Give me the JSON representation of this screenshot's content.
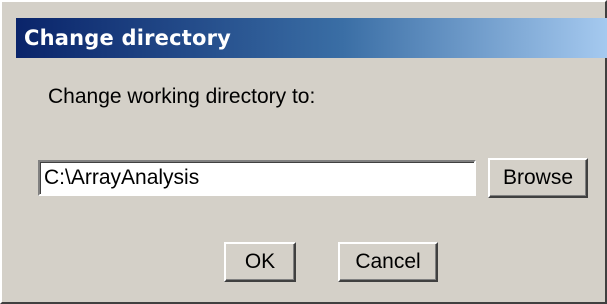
{
  "dialog": {
    "title": "Change directory",
    "prompt": "Change working directory to:",
    "path_value": "C:\\ArrayAnalysis",
    "browse_label": "Browse",
    "ok_label": "OK",
    "cancel_label": "Cancel"
  }
}
